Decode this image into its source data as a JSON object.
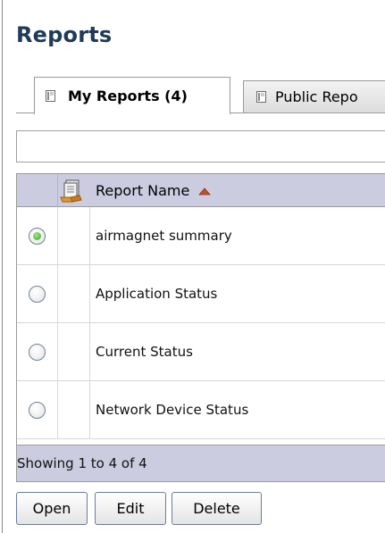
{
  "page": {
    "title": "Reports"
  },
  "tabs": [
    {
      "label": "My Reports (4)",
      "active": true,
      "icon": "report-page-icon"
    },
    {
      "label": "Public Repo",
      "active": false,
      "icon": "report-page-icon"
    }
  ],
  "filter": {
    "value": "",
    "placeholder": ""
  },
  "grid": {
    "header": {
      "name_label": "Report Name",
      "sort": "ascending",
      "header_icon": "reports-stack-icon"
    },
    "rows": [
      {
        "name": "airmagnet summary",
        "selected": true
      },
      {
        "name": "Application Status",
        "selected": false
      },
      {
        "name": "Current Status",
        "selected": false
      },
      {
        "name": "Network Device Status",
        "selected": false
      }
    ],
    "footer": "Showing 1 to 4 of 4"
  },
  "buttons": {
    "open": "Open",
    "edit": "Edit",
    "delete": "Delete"
  },
  "colors": {
    "title": "#1f3a5a",
    "grid_header": "#cccce0",
    "selected_radio": "#3aa52c",
    "sort_arrow": "#c0502a"
  }
}
